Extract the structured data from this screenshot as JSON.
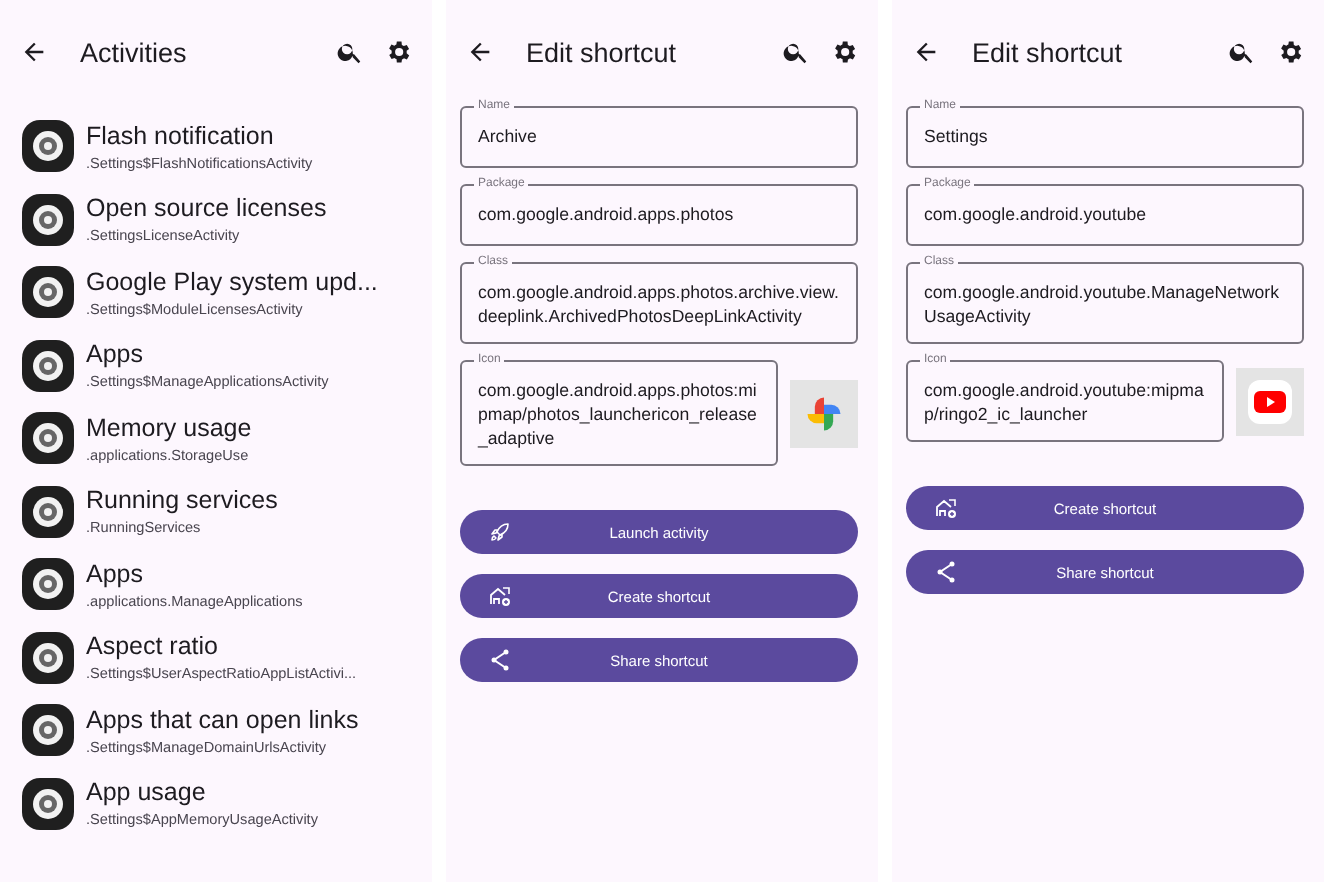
{
  "screens": [
    {
      "kind": "list",
      "title": "Activities",
      "items": [
        {
          "title": "Flash notification",
          "subtitle": ".Settings$FlashNotificationsActivity"
        },
        {
          "title": "Open source licenses",
          "subtitle": ".SettingsLicenseActivity"
        },
        {
          "title": "Google Play system upd...",
          "subtitle": ".Settings$ModuleLicensesActivity"
        },
        {
          "title": "Apps",
          "subtitle": ".Settings$ManageApplicationsActivity"
        },
        {
          "title": "Memory usage",
          "subtitle": ".applications.StorageUse"
        },
        {
          "title": "Running services",
          "subtitle": ".RunningServices"
        },
        {
          "title": "Apps",
          "subtitle": ".applications.ManageApplications"
        },
        {
          "title": "Aspect ratio",
          "subtitle": ".Settings$UserAspectRatioAppListActivi..."
        },
        {
          "title": "Apps that can open links",
          "subtitle": ".Settings$ManageDomainUrlsActivity"
        },
        {
          "title": "App usage",
          "subtitle": ".Settings$AppMemoryUsageActivity"
        }
      ]
    },
    {
      "kind": "editor",
      "title": "Edit shortcut",
      "preview": {
        "kind": "photos"
      },
      "fields": [
        {
          "label": "Name",
          "value": "Archive"
        },
        {
          "label": "Package",
          "value": "com.google.android.apps.photos"
        },
        {
          "label": "Class",
          "value": "com.google.android.apps.photos.archive.view.deeplink.ArchivedPhotosDeepLinkActivity"
        },
        {
          "label": "Icon",
          "value": "com.google.android.apps.photos:mipmap/photos_launchericon_release_adaptive"
        }
      ],
      "buttons": [
        {
          "kind": "launch",
          "label": "Launch activity"
        },
        {
          "kind": "create",
          "label": "Create shortcut"
        },
        {
          "kind": "share",
          "label": "Share shortcut"
        }
      ]
    },
    {
      "kind": "editor",
      "title": "Edit shortcut",
      "preview": {
        "kind": "youtube"
      },
      "fields": [
        {
          "label": "Name",
          "value": "Settings"
        },
        {
          "label": "Package",
          "value": "com.google.android.youtube"
        },
        {
          "label": "Class",
          "value": "com.google.android.youtube.ManageNetworkUsageActivity"
        },
        {
          "label": "Icon",
          "value": "com.google.android.youtube:mipmap/ringo2_ic_launcher"
        }
      ],
      "buttons": [
        {
          "kind": "create",
          "label": "Create shortcut"
        },
        {
          "kind": "share",
          "label": "Share shortcut"
        }
      ]
    }
  ]
}
